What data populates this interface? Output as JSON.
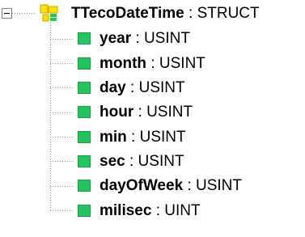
{
  "root": {
    "name": "TTecoDateTime",
    "separator": " : ",
    "type": "STRUCT",
    "expander_icon": "minus-box-icon",
    "icon": "struct-icon"
  },
  "fields": [
    {
      "name": "year",
      "separator": " : ",
      "type": "USINT"
    },
    {
      "name": "month",
      "separator": " : ",
      "type": "USINT"
    },
    {
      "name": "day",
      "separator": " : ",
      "type": "USINT"
    },
    {
      "name": "hour",
      "separator": " : ",
      "type": "USINT"
    },
    {
      "name": "min",
      "separator": " : ",
      "type": "USINT"
    },
    {
      "name": "sec",
      "separator": " : ",
      "type": "USINT"
    },
    {
      "name": "dayOfWeek",
      "separator": " : ",
      "type": "USINT"
    },
    {
      "name": "milisec",
      "separator": " : ",
      "type": "UINT"
    }
  ],
  "colors": {
    "field_icon": "#22c55e",
    "struct_icon_yellow": "#ffdf00",
    "struct_icon_green": "#1fc94b",
    "connector": "#8c8c8c"
  }
}
